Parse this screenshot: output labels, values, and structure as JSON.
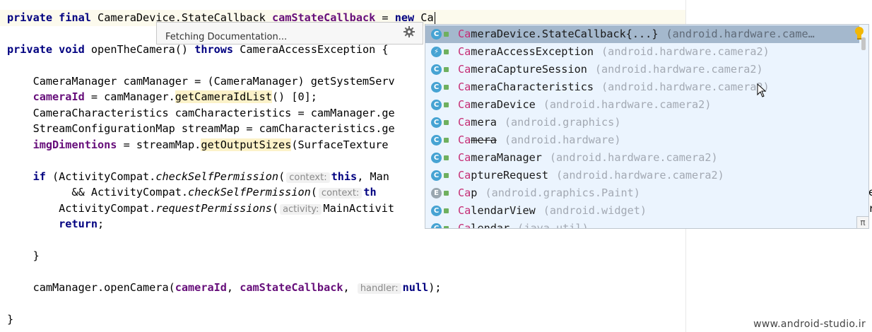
{
  "code": {
    "line1": {
      "kw1": "private",
      "kw2": "final",
      "type": "CameraDevice.StateCallback",
      "field": "camStateCallback",
      "eq": " = ",
      "kw3": "new",
      "typed": "Ca"
    },
    "line2": {
      "kw1": "private",
      "kw2": "void",
      "text1": "openTheCamera() ",
      "kw3": "throws",
      "text2": "CameraAccessException {"
    },
    "line3": {
      "text": "    CameraManager camManager = (CameraManager) getSystemServ"
    },
    "line4": {
      "field": "cameraId",
      "text1": " = camManager.",
      "call": "getCameraIdList",
      "text2": "() [0];"
    },
    "line5": {
      "text": "    CameraCharacteristics camCharacteristics = camManager.ge"
    },
    "line6": {
      "text": "    StreamConfigurationMap streamMap = camCharacteristics.ge"
    },
    "line7": {
      "field": "imgDimentions",
      "text1": " = streamMap.",
      "call": "getOutputSizes",
      "text2": "(SurfaceTexture"
    },
    "line8": {
      "kw": "if",
      "text1": " (ActivityCompat.",
      "method": "checkSelfPermission",
      "text2": "(",
      "hint": "context:",
      "kw2": "this",
      "text3": ", Man"
    },
    "line9": {
      "text1": "          && ActivityCompat.",
      "method": "checkSelfPermission",
      "text2": "(",
      "hint": "context:",
      "kw": "th"
    },
    "line10": {
      "text1": "        ActivityCompat.",
      "method": "requestPermissions",
      "text2": "(",
      "hint": "activity:",
      "text3": "MainActivit"
    },
    "line11": {
      "kw": "return",
      "text": ";"
    },
    "line12": {
      "text": "    }"
    },
    "line13": {
      "text1": "    camManager.openCamera(",
      "field1": "cameraId",
      "text2": ", ",
      "field2": "camStateCallback",
      "text3": ", ",
      "hint": "handler:",
      "kw": "null",
      "text4": ");"
    },
    "line14": {
      "text": "}"
    },
    "edge_e": "e",
    "edge_r": "r"
  },
  "doc_popup": {
    "text": "Fetching Documentation...",
    "icon": "gear-icon"
  },
  "completion": {
    "items": [
      {
        "match": "Ca",
        "rest": "meraDevice.StateCallback{...}",
        "pkg": "(android.hardware.came…",
        "icon": "C",
        "selected": true
      },
      {
        "match": "Ca",
        "rest": "meraAccessException",
        "pkg": "(android.hardware.camera2)",
        "icon": "⚡",
        "selected": false
      },
      {
        "match": "Ca",
        "rest": "meraCaptureSession",
        "pkg": "(android.hardware.camera2)",
        "icon": "C",
        "selected": false
      },
      {
        "match": "Ca",
        "rest": "meraCharacteristics",
        "pkg": "(android.hardware.camera2)",
        "icon": "C",
        "selected": false
      },
      {
        "match": "Ca",
        "rest": "meraDevice",
        "pkg": "(android.hardware.camera2)",
        "icon": "C",
        "selected": false
      },
      {
        "match": "Ca",
        "rest": "mera",
        "pkg": "(android.graphics)",
        "icon": "C",
        "selected": false
      },
      {
        "match": "Ca",
        "rest": "mera",
        "pkg": "(android.hardware)",
        "icon": "C",
        "selected": false,
        "deprecated": true
      },
      {
        "match": "Ca",
        "rest": "meraManager",
        "pkg": "(android.hardware.camera2)",
        "icon": "C",
        "selected": false
      },
      {
        "match": "Ca",
        "rest": "ptureRequest",
        "pkg": "(android.hardware.camera2)",
        "icon": "C",
        "selected": false
      },
      {
        "match": "Ca",
        "rest": "p",
        "pkg": "(android.graphics.Paint)",
        "icon": "E",
        "selected": false
      },
      {
        "match": "Ca",
        "rest": "lendarView",
        "pkg": "(android.widget)",
        "icon": "C",
        "selected": false
      },
      {
        "match": "Ca",
        "rest": "lendar",
        "pkg": "(java.util)",
        "icon": "C",
        "selected": false
      }
    ],
    "pi_button": "π"
  },
  "watermark": "www.android-studio.ir",
  "colors": {
    "keyword": "#000080",
    "field": "#660e7a",
    "match": "#c52d75",
    "popup_bg": "#ebf4fe",
    "selected_bg": "#a4b8cd"
  }
}
